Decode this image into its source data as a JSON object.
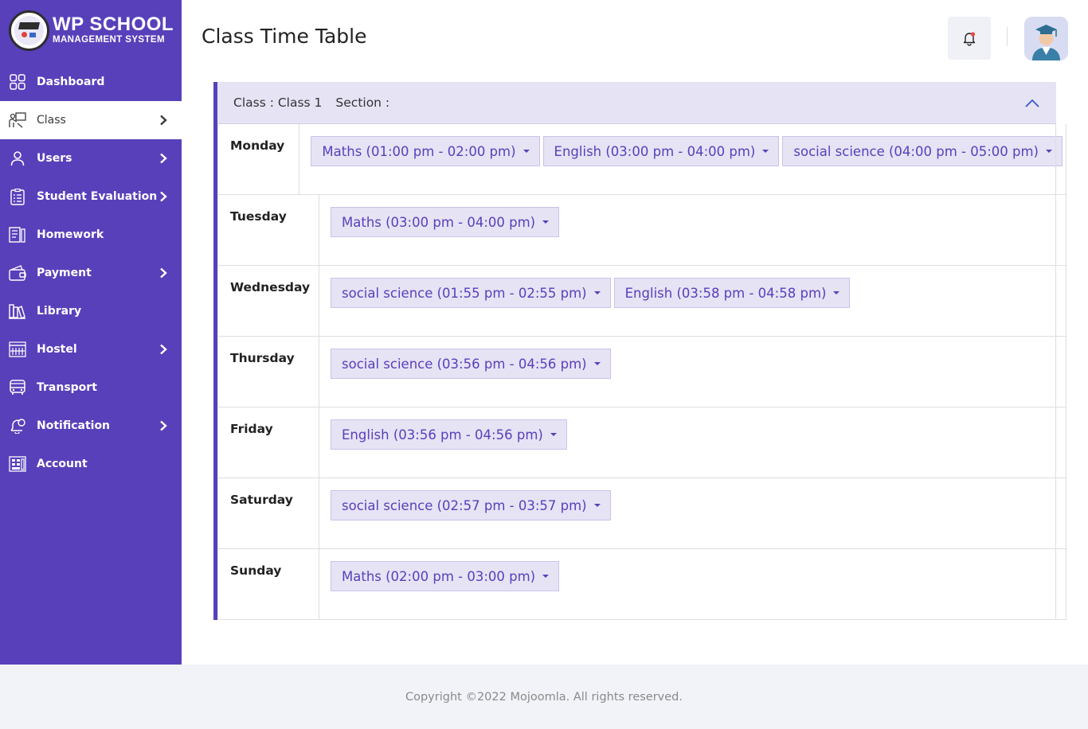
{
  "brand": {
    "title": "WP SCHOOL",
    "subtitle": "MANAGEMENT SYSTEM"
  },
  "sidebar": {
    "items": [
      {
        "label": "Dashboard",
        "icon": "dashboard-icon",
        "submenu": false,
        "active": false
      },
      {
        "label": "Class",
        "icon": "class-icon",
        "submenu": true,
        "active": true
      },
      {
        "label": "Users",
        "icon": "user-icon",
        "submenu": true,
        "active": false
      },
      {
        "label": "Student Evaluation",
        "icon": "evaluation-icon",
        "submenu": true,
        "active": false
      },
      {
        "label": "Homework",
        "icon": "homework-icon",
        "submenu": false,
        "active": false
      },
      {
        "label": "Payment",
        "icon": "wallet-icon",
        "submenu": true,
        "active": false
      },
      {
        "label": "Library",
        "icon": "library-icon",
        "submenu": false,
        "active": false
      },
      {
        "label": "Hostel",
        "icon": "hostel-icon",
        "submenu": true,
        "active": false
      },
      {
        "label": "Transport",
        "icon": "bus-icon",
        "submenu": false,
        "active": false
      },
      {
        "label": "Notification",
        "icon": "notification-icon",
        "submenu": true,
        "active": false
      },
      {
        "label": "Account",
        "icon": "account-icon",
        "submenu": false,
        "active": false
      }
    ]
  },
  "header": {
    "title": "Class Time Table"
  },
  "card": {
    "class_label": "Class : Class 1",
    "section_label": "Section :"
  },
  "timetable": [
    {
      "day": "Monday",
      "slots": [
        "Maths (01:00 pm - 02:00 pm)",
        "English (03:00 pm - 04:00 pm)",
        "social science (04:00 pm - 05:00 pm)"
      ]
    },
    {
      "day": "Tuesday",
      "slots": [
        "Maths (03:00 pm - 04:00 pm)"
      ]
    },
    {
      "day": "Wednesday",
      "slots": [
        "social science (01:55 pm - 02:55 pm)",
        "English (03:58 pm - 04:58 pm)"
      ]
    },
    {
      "day": "Thursday",
      "slots": [
        "social science (03:56 pm - 04:56 pm)"
      ]
    },
    {
      "day": "Friday",
      "slots": [
        "English (03:56 pm - 04:56 pm)"
      ]
    },
    {
      "day": "Saturday",
      "slots": [
        "social science (02:57 pm - 03:57 pm)"
      ]
    },
    {
      "day": "Sunday",
      "slots": [
        "Maths (02:00 pm - 03:00 pm)"
      ]
    }
  ],
  "footer": {
    "copyright": "Copyright ©2022 Mojoomla. All rights reserved."
  },
  "colors": {
    "primary": "#5840bb",
    "slot_bg": "#e6e3f5",
    "footer_bg": "#f1f3f8"
  }
}
